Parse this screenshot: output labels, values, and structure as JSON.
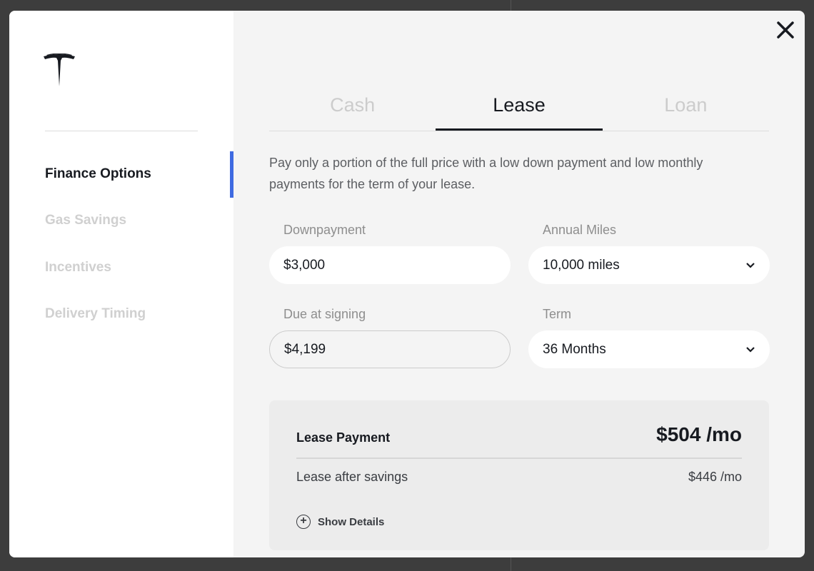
{
  "sidebar": {
    "items": [
      {
        "label": "Finance Options",
        "active": true
      },
      {
        "label": "Gas Savings"
      },
      {
        "label": "Incentives"
      },
      {
        "label": "Delivery Timing"
      }
    ],
    "accent": "#3e6ae1"
  },
  "tabs": [
    {
      "label": "Cash"
    },
    {
      "label": "Lease",
      "active": true
    },
    {
      "label": "Loan"
    }
  ],
  "description": "Pay only a portion of the full price with a low down payment and low monthly payments for the term of your lease.",
  "form": {
    "downpayment": {
      "label": "Downpayment",
      "value": "$3,000"
    },
    "annual_miles": {
      "label": "Annual Miles",
      "value": "10,000 miles"
    },
    "due_at_signing": {
      "label": "Due at signing",
      "value": "$4,199"
    },
    "term": {
      "label": "Term",
      "value": "36 Months"
    }
  },
  "summary": {
    "lease_payment_label": "Lease Payment",
    "lease_payment_value": "$504 /mo",
    "after_savings_label": "Lease after savings",
    "after_savings_value": "$446 /mo",
    "show_details": "Show Details"
  }
}
